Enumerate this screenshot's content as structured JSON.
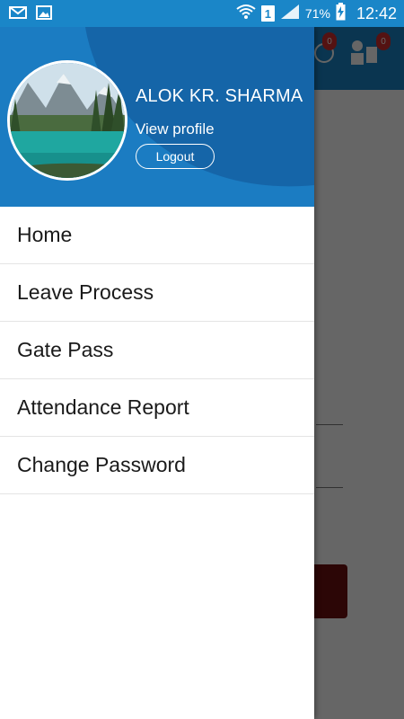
{
  "status_bar": {
    "left_icons": [
      "mail-icon",
      "image-icon"
    ],
    "right_icons": [
      "wifi-icon",
      "signal-icon",
      "battery-icon"
    ],
    "sim_slot": "1",
    "battery_percent": "71%",
    "time": "12:42"
  },
  "drawer": {
    "profile": {
      "name": "ALOK KR. SHARMA",
      "view_profile_label": "View profile",
      "logout_label": "Logout"
    },
    "menu_items": [
      {
        "label": "Home"
      },
      {
        "label": "Leave Process"
      },
      {
        "label": "Gate Pass"
      },
      {
        "label": "Attendance Report"
      },
      {
        "label": "Change Password"
      }
    ]
  },
  "background_app": {
    "badges": [
      "0",
      "0"
    ]
  },
  "colors": {
    "primary": "#1a86c8",
    "header_dark": "#1565a8",
    "badge_red": "#d32f2f"
  }
}
